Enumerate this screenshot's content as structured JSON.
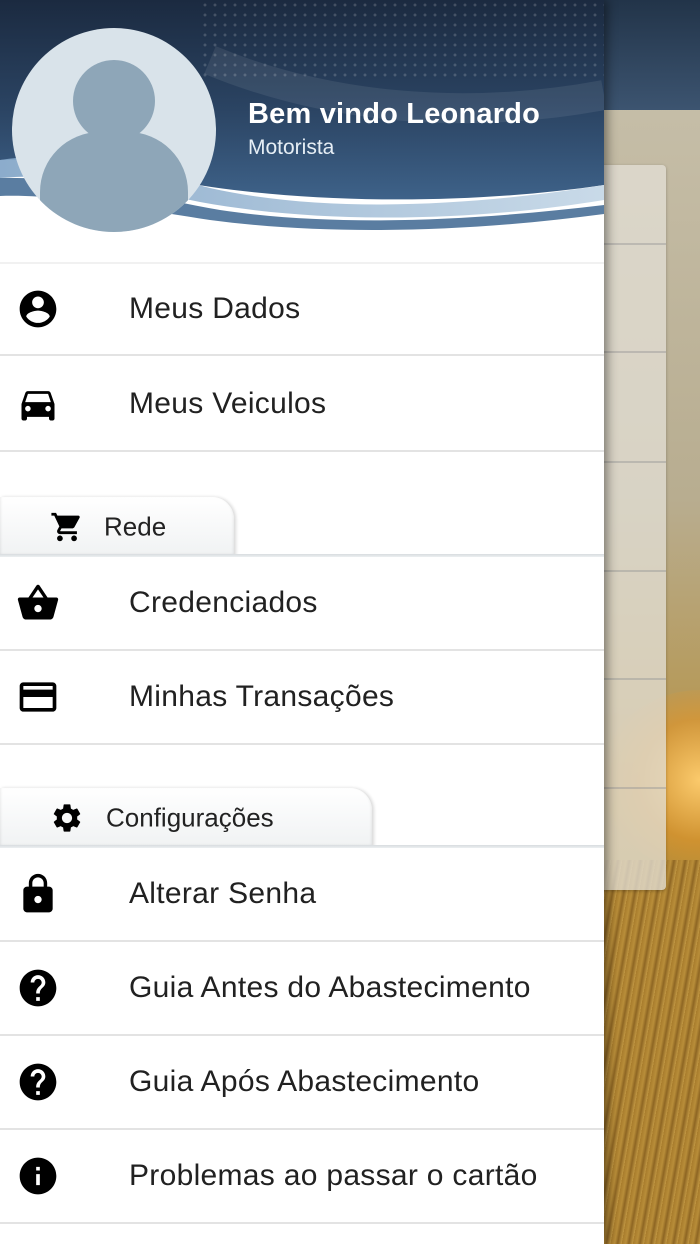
{
  "header": {
    "welcome": "Bem vindo Leonardo",
    "role": "Motorista",
    "colors": {
      "dark": "#1b2d45",
      "mid": "#4c6d90",
      "light": "#a9c4dc"
    }
  },
  "menu": {
    "meus_dados": {
      "label": "Meus Dados",
      "icon": "account-circle-icon"
    },
    "meus_veiculos": {
      "label": "Meus Veiculos",
      "icon": "car-icon"
    },
    "credenciados": {
      "label": "Credenciados",
      "icon": "basket-icon"
    },
    "minhas_transacoes": {
      "label": "Minhas Transações",
      "icon": "credit-card-icon"
    },
    "alterar_senha": {
      "label": "Alterar Senha",
      "icon": "lock-icon"
    },
    "guia_antes": {
      "label": "Guia Antes do Abastecimento",
      "icon": "help-circle-icon"
    },
    "guia_apos": {
      "label": "Guia Após Abastecimento",
      "icon": "help-circle-icon"
    },
    "problemas_cartao": {
      "label": "Problemas ao passar o cartão",
      "icon": "info-circle-icon"
    }
  },
  "sections": {
    "rede": {
      "label": "Rede",
      "icon": "cart-icon"
    },
    "configuracoes": {
      "label": "Configurações",
      "icon": "gear-icon"
    }
  }
}
